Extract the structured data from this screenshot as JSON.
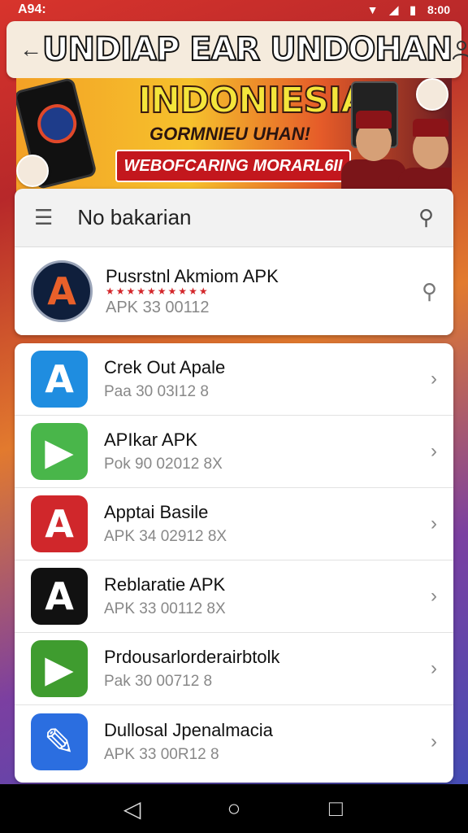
{
  "status_bar": {
    "time": "A94:",
    "right_time": "8:00"
  },
  "header": {
    "title": "UNDIAP EAR UNDOHAN"
  },
  "banner": {
    "headline": "INDONIESIA",
    "subheadline": "GORMNIEU UHAN!",
    "ribbon": "WEBOFCARING MORARL6II"
  },
  "search": {
    "label": "No bakarian"
  },
  "featured": {
    "name": "Pusrstnl Akmiom APK",
    "meta": "APK 33 00112",
    "logo_letter": "A"
  },
  "apps": [
    {
      "name": "Crek Out Apale",
      "meta": "Paa 30 03I12  8",
      "icon_letter": "A",
      "icon_color": "#1f8de0"
    },
    {
      "name": "APIkar APK",
      "meta": "Pok 90 02012  8X",
      "icon_letter": "▶",
      "icon_color": "#49b64a"
    },
    {
      "name": "Apptai Basile",
      "meta": "APK 34 02912  8X",
      "icon_letter": "A",
      "icon_color": "#d0272b"
    },
    {
      "name": "Reblaratie APK",
      "meta": "APK 33 00112  8X",
      "icon_letter": "A",
      "icon_color": "#111111"
    },
    {
      "name": "Prdousarlorderairbtolk",
      "meta": "Pak 30 00712  8",
      "icon_letter": "▶",
      "icon_color": "#3f9c2f"
    },
    {
      "name": "Dullosal Jpenalmacia",
      "meta": "APK 33 00R12  8",
      "icon_letter": "✎",
      "icon_color": "#2b6ee0"
    }
  ],
  "nav": {
    "back": "◁",
    "home": "○",
    "recents": "□"
  }
}
